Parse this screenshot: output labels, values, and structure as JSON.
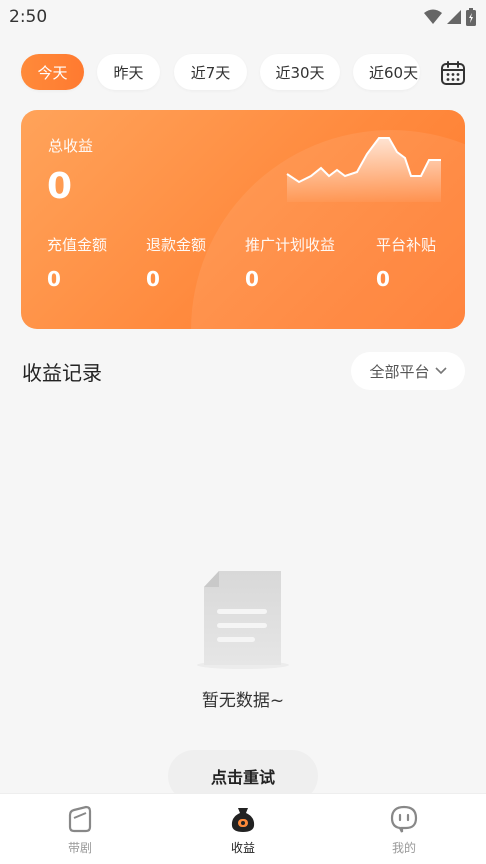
{
  "status_bar": {
    "time": "2:50"
  },
  "filters": {
    "items": [
      {
        "label": "今天",
        "active": true
      },
      {
        "label": "昨天",
        "active": false
      },
      {
        "label": "近7天",
        "active": false
      },
      {
        "label": "近30天",
        "active": false
      },
      {
        "label": "近60天",
        "active": false
      }
    ],
    "calendar_icon": "calendar-icon"
  },
  "summary": {
    "total_label": "总收益",
    "total_value": "0",
    "metrics": [
      {
        "label": "充值金额",
        "value": "0"
      },
      {
        "label": "退款金额",
        "value": "0"
      },
      {
        "label": "推广计划收益",
        "value": "0"
      },
      {
        "label": "平台补贴",
        "value": "0"
      }
    ],
    "colors": {
      "start": "#ffa35a",
      "end": "#ff7a2e"
    }
  },
  "records": {
    "title": "收益记录",
    "platform_select": "全部平台"
  },
  "empty_state": {
    "message": "暂无数据~",
    "retry_label": "点击重试"
  },
  "bottom_nav": {
    "items": [
      {
        "label": "带剧",
        "icon": "tv-icon",
        "active": false
      },
      {
        "label": "收益",
        "icon": "money-bag-icon",
        "active": true
      },
      {
        "label": "我的",
        "icon": "robot-face-icon",
        "active": false
      }
    ]
  },
  "accent_color": "#ff7f35"
}
